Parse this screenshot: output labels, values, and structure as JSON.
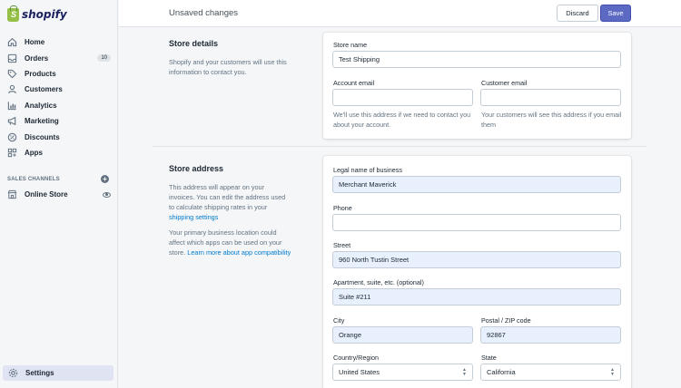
{
  "brand": {
    "logo_text": "shopify",
    "logo_letter": "S"
  },
  "nav": {
    "items": [
      {
        "label": "Home",
        "icon": "home-icon"
      },
      {
        "label": "Orders",
        "icon": "orders-icon",
        "badge": "10"
      },
      {
        "label": "Products",
        "icon": "tag-icon"
      },
      {
        "label": "Customers",
        "icon": "person-icon"
      },
      {
        "label": "Analytics",
        "icon": "chart-icon"
      },
      {
        "label": "Marketing",
        "icon": "megaphone-icon"
      },
      {
        "label": "Discounts",
        "icon": "discount-icon"
      },
      {
        "label": "Apps",
        "icon": "apps-icon"
      }
    ],
    "channels_heading": "SALES CHANNELS",
    "online_store": "Online Store",
    "settings": "Settings"
  },
  "topbar": {
    "status": "Unsaved changes",
    "discard": "Discard",
    "save": "Save"
  },
  "store_details": {
    "title": "Store details",
    "description": "Shopify and your customers will use this information to contact you.",
    "store_name_label": "Store name",
    "store_name_value": "Test Shipping",
    "account_email_label": "Account email",
    "account_email_value": "",
    "account_email_help": "We'll use this address if we need to contact you about your account.",
    "customer_email_label": "Customer email",
    "customer_email_value": "",
    "customer_email_help": "Your customers will see this address if you email them"
  },
  "store_address": {
    "title": "Store address",
    "desc1": "This address will appear on your invoices. You can edit the address used to calculate shipping rates in your",
    "desc1_link": "shipping settings",
    "desc2": "Your primary business location could affect which apps can be used on your store.",
    "desc2_link": "Learn more about app compatibility",
    "legal_name_label": "Legal name of business",
    "legal_name_value": "Merchant Maverick",
    "phone_label": "Phone",
    "phone_value": "",
    "street_label": "Street",
    "street_value": "960 North Tustin Street",
    "apt_label": "Apartment, suite, etc. (optional)",
    "apt_value": "Suite #211",
    "city_label": "City",
    "city_value": "Orange",
    "zip_label": "Postal / ZIP code",
    "zip_value": "92867",
    "country_label": "Country/Region",
    "country_value": "United States",
    "state_label": "State",
    "state_value": "California"
  },
  "colors": {
    "accent": "#5c6ac4",
    "link": "#007ace",
    "autofill": "#e8f0fe",
    "logo_green": "#95bf47"
  }
}
